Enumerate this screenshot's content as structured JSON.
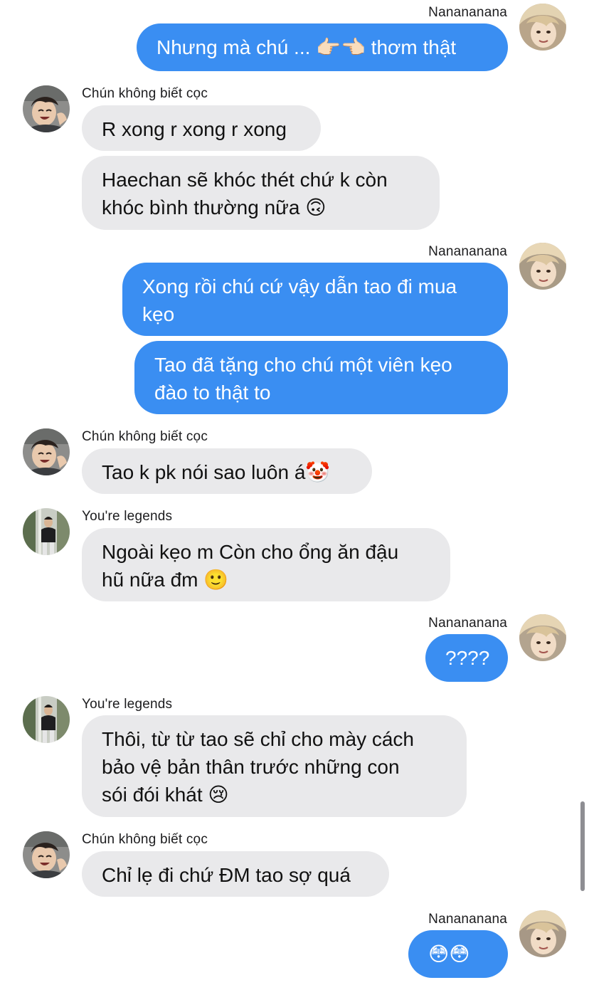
{
  "messages": [
    {
      "sender": "Nanananana",
      "side": "out",
      "text": "Nhưng mà chú ... 👉🏻👈🏻 thơm thật"
    },
    {
      "sender": "Chún không biết cọc",
      "side": "in",
      "text": "R xong r xong r xong"
    },
    {
      "side": "in",
      "lines": [
        "Haechan sẽ khóc thét chứ k còn",
        "khóc bình thường nữa 🙃"
      ]
    },
    {
      "sender": "Nanananana",
      "side": "out",
      "lines": [
        "Xong rồi chú cứ vậy dẫn tao đi mua",
        "kẹo"
      ]
    },
    {
      "side": "out",
      "lines": [
        "Tao đã tặng cho chú một viên kẹo",
        "đào to thật to"
      ]
    },
    {
      "sender": "Chún không biết cọc",
      "side": "in",
      "text": "Tao k pk nói sao luôn á🤡"
    },
    {
      "sender": "You're legends",
      "side": "in",
      "lines": [
        "Ngoài kẹo m Còn cho ổng ăn đậu",
        "hũ nữa đm 🙂"
      ]
    },
    {
      "sender": "Nanananana",
      "side": "out",
      "text": "????"
    },
    {
      "sender": "You're legends",
      "side": "in",
      "lines": [
        "Thôi, từ từ tao sẽ chỉ cho mày cách",
        "bảo vệ bản thân trước những con",
        "sói đói khát 😢"
      ]
    },
    {
      "sender": "Chún không biết cọc",
      "side": "in",
      "text": "Chỉ lẹ đi chứ ĐM tao sợ quá"
    },
    {
      "sender": "Nanananana",
      "side": "out",
      "text": "😳😳"
    }
  ],
  "colors": {
    "outgoing_bubble": "#3a8ef2",
    "incoming_bubble": "#e9e9eb",
    "outgoing_text": "#ffffff",
    "incoming_text": "#111111"
  },
  "avatars": {
    "nanananana": "blond-portrait-avatar",
    "chun": "laughing-boy-avatar",
    "legends": "standing-boy-avatar"
  }
}
